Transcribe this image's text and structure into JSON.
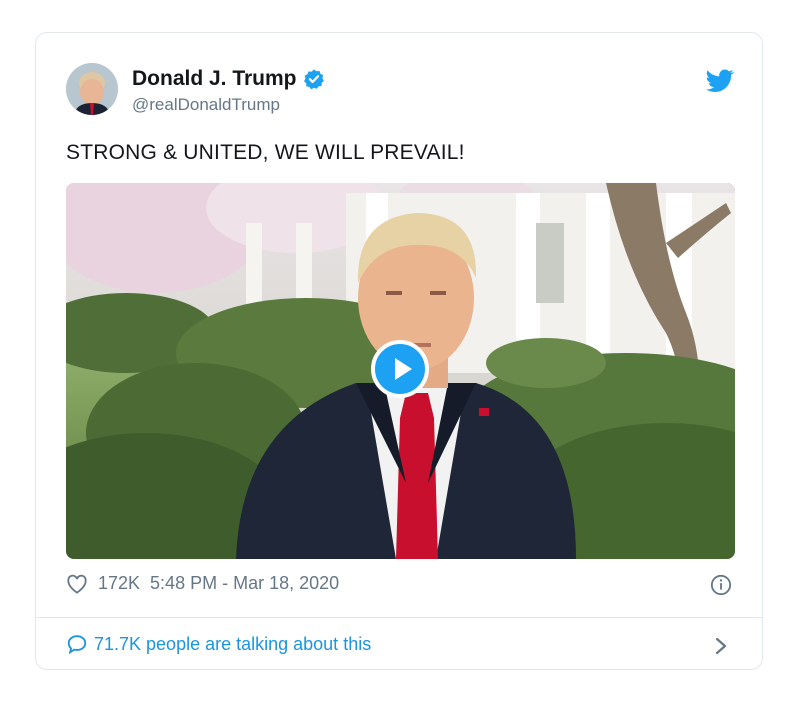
{
  "tweet": {
    "author_name": "Donald J. Trump",
    "handle": "@realDonaldTrump",
    "text": "STRONG & UNITED, WE WILL PREVAIL!",
    "likes": "172K",
    "timestamp": "5:48 PM - Mar 18, 2020",
    "talking": "71.7K people are talking about this"
  },
  "icons": {
    "verified": "verified-badge-icon",
    "brand": "twitter-bird-icon",
    "like": "heart-icon",
    "info": "info-icon",
    "reply": "speech-bubble-icon",
    "more": "chevron-right-icon",
    "play": "play-icon"
  },
  "colors": {
    "accent": "#1da1f2",
    "link": "#1b95e0",
    "muted": "#657786",
    "border": "#e1e8ed"
  }
}
